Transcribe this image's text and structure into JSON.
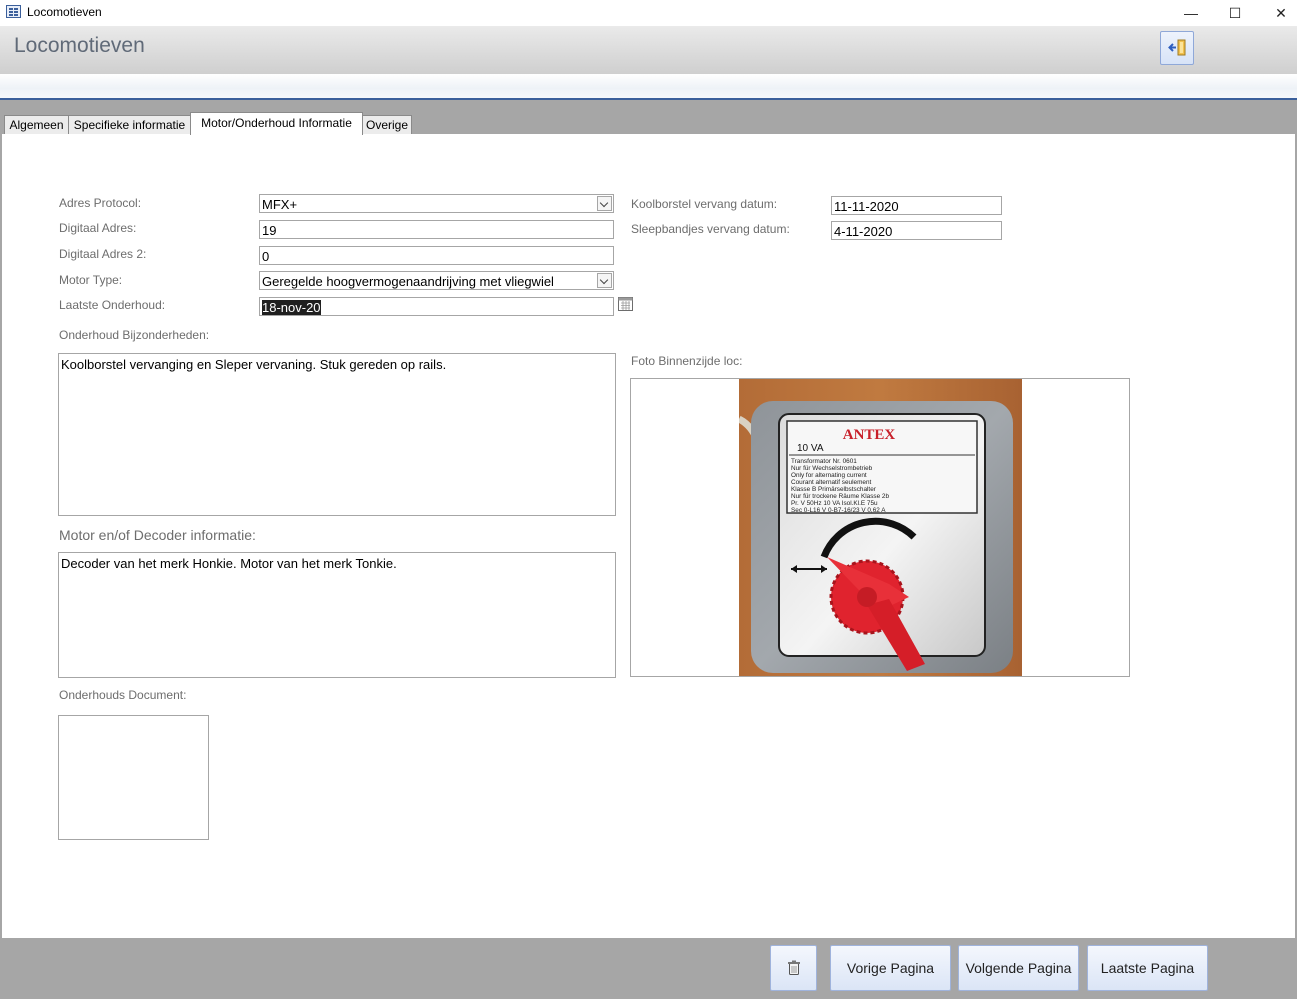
{
  "window": {
    "title": "Locomotieven",
    "minimize_glyph": "—",
    "maximize_glyph": "☐",
    "close_glyph": "✕"
  },
  "header": {
    "title": "Locomotieven",
    "exit_icon": "exit-door-icon"
  },
  "tabs": [
    {
      "label": "Algemeen"
    },
    {
      "label": "Specifieke informatie"
    },
    {
      "label": "Motor/Onderhoud Informatie",
      "active": true
    },
    {
      "label": "Overige"
    }
  ],
  "form": {
    "adres_protocol": {
      "label": "Adres Protocol:",
      "value": "MFX+"
    },
    "digitaal_adres": {
      "label": "Digitaal Adres:",
      "value": "19"
    },
    "digitaal_adres_2": {
      "label": "Digitaal Adres 2:",
      "value": "0"
    },
    "motor_type": {
      "label": "Motor Type:",
      "value": "Geregelde hoogvermogenaandrijving met vliegwiel"
    },
    "laatste_onderhoud": {
      "label": "Laatste Onderhoud:",
      "value": "18-nov-20"
    },
    "koolborstel": {
      "label": "Koolborstel vervang datum:",
      "value": "11-11-2020"
    },
    "sleepbandjes": {
      "label": "Sleepbandjes vervang datum:",
      "value": "4-11-2020"
    },
    "onderhoud_bijzonderheden": {
      "label": "Onderhoud Bijzonderheden:",
      "value": "Koolborstel vervanging en Sleper vervaning. Stuk gereden op rails."
    },
    "motor_decoder": {
      "label": "Motor en/of Decoder informatie:",
      "value": "Decoder van het merk Honkie. Motor van het merk Tonkie."
    },
    "onderhouds_document": {
      "label": "Onderhouds Document:"
    },
    "foto": {
      "label": "Foto Binnenzijde loc:",
      "brand": "ANTEX",
      "rating": "10 VA",
      "plate_lines": [
        "Transformator        Nr. 0601",
        "Nur  für   Wechselstrombetrieb",
        "Only  for  alternating  current",
        "Courant   alternatif   seulement",
        "Klasse B   Primärselbstschalter",
        "Nur für trockene Räume Klasse 2b",
        "Pr.       V 50Hz 10 VA Isol.Kl.E 75u",
        "Sec 0-L16 V 0-B7-16/23 V 0,62 A"
      ]
    }
  },
  "footer": {
    "delete_icon": "trash-icon",
    "vorige": "Vorige Pagina",
    "volgende": "Volgende Pagina",
    "laatste": "Laatste Pagina"
  },
  "colors": {
    "accent": "#3b5f9b",
    "frame_gray": "#a6a6a6",
    "label_gray": "#6d6d6d",
    "photo_knob": "#e0232e",
    "photo_wood": "#b06a35"
  }
}
